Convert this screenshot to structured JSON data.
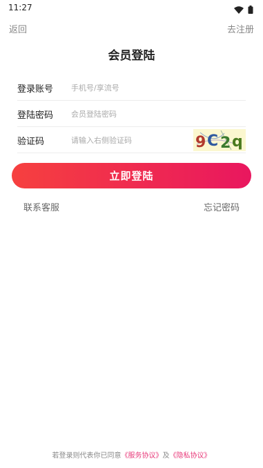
{
  "status_bar": {
    "time": "11:27"
  },
  "nav": {
    "back_label": "返回",
    "register_label": "去注册"
  },
  "title": "会员登陆",
  "form": {
    "account": {
      "label": "登录账号",
      "placeholder": "手机号/享流号",
      "value": ""
    },
    "password": {
      "label": "登陆密码",
      "placeholder": "会员登陆密码",
      "value": ""
    },
    "captcha": {
      "label": "验证码",
      "placeholder": "请输入右侧验证码",
      "value": "",
      "image_text": [
        "9",
        "C",
        "2",
        "q"
      ]
    }
  },
  "login_button_label": "立即登陆",
  "links": {
    "contact": "联系客服",
    "forgot": "忘记密码"
  },
  "agreement": {
    "prefix": "若登录则代表你已同意",
    "service": "《服务协议》",
    "conjunction": "及",
    "privacy": "《隐私协议》"
  },
  "colors": {
    "gradient_start": "#f6403f",
    "gradient_end": "#e9175f",
    "link_pink": "#e83a7a"
  },
  "icons": [
    "wifi-icon",
    "battery-icon"
  ]
}
